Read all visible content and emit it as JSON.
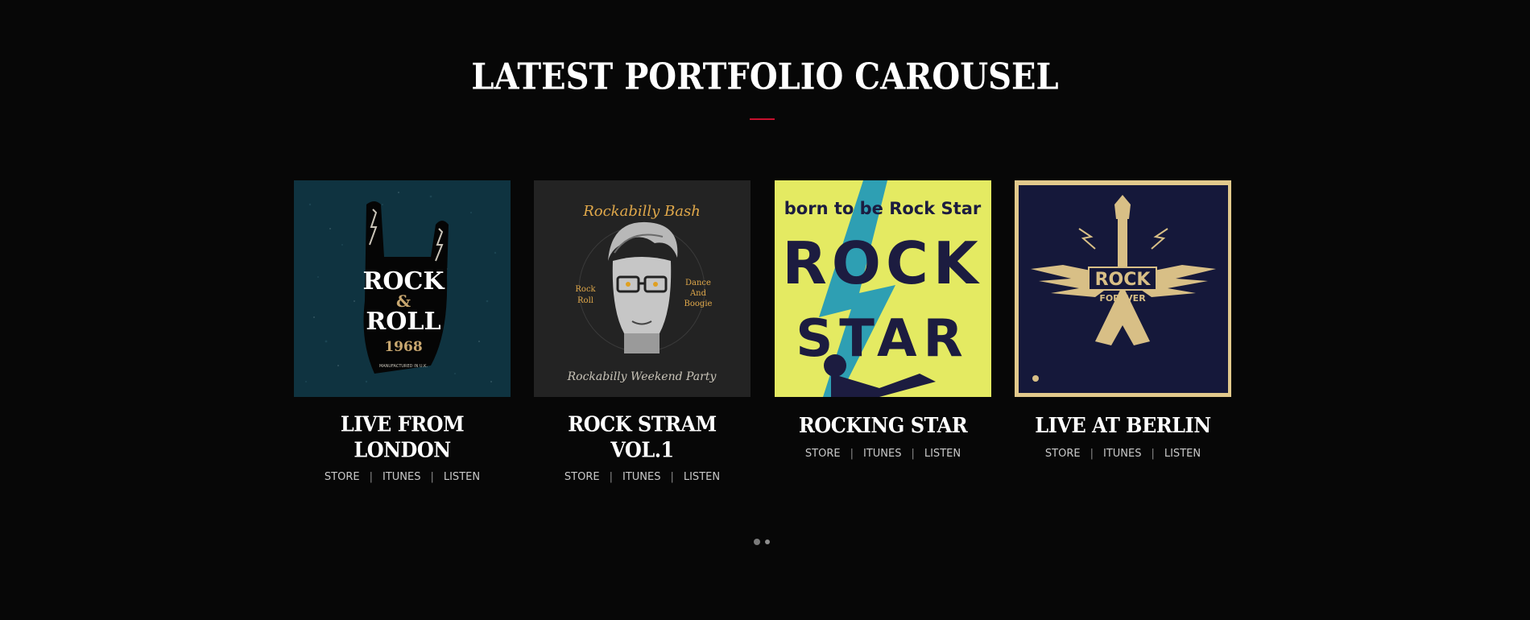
{
  "section": {
    "title": "LATEST PORTFOLIO CAROUSEL",
    "accent_color": "#c8102e"
  },
  "cards": [
    {
      "title": "LIVE FROM LONDON",
      "art_text": [
        "ROCK",
        "&",
        "ROLL",
        "1968",
        "MANUFACTURED IN U.K."
      ],
      "links": [
        "STORE",
        "ITUNES",
        "LISTEN"
      ]
    },
    {
      "title": "ROCK STRAM VOL.1",
      "art_text": [
        "Rockabilly Bash",
        "Rockabilly Weekend Party"
      ],
      "links": [
        "STORE",
        "ITUNES",
        "LISTEN"
      ]
    },
    {
      "title": "ROCKING STAR",
      "art_text": [
        "born to be Rock Star",
        "ROCK",
        "STAR"
      ],
      "links": [
        "STORE",
        "ITUNES",
        "LISTEN"
      ]
    },
    {
      "title": "LIVE AT BERLIN",
      "art_text": [
        "ROCK",
        "FOREVER"
      ],
      "links": [
        "STORE",
        "ITUNES",
        "LISTEN"
      ]
    }
  ],
  "pagination": {
    "pages": 2,
    "active": 1
  }
}
